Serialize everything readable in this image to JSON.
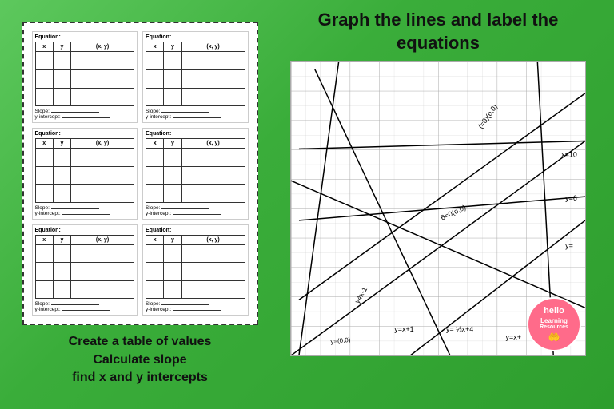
{
  "left": {
    "worksheet": {
      "blocks": [
        {
          "label": "Equation:",
          "cols": [
            "x",
            "y",
            "(x, y)"
          ]
        },
        {
          "label": "Equation:",
          "cols": [
            "x",
            "y",
            "(x, y)"
          ]
        },
        {
          "label": "Equation:",
          "cols": [
            "x",
            "y",
            "(x, y)"
          ]
        },
        {
          "label": "Equation:",
          "cols": [
            "x",
            "y",
            "(x, y)"
          ]
        },
        {
          "label": "Equation:",
          "cols": [
            "x",
            "y",
            "(x, y)"
          ]
        },
        {
          "label": "Equation:",
          "cols": [
            "x",
            "y",
            "(x, y)"
          ]
        }
      ],
      "slope_label": "Slope:",
      "intercept_label": "y-intercept:"
    },
    "caption_lines": [
      "Create a table of values",
      "Calculate slope",
      "find x and y intercepts"
    ]
  },
  "right": {
    "title": "Graph the lines and label the equations",
    "badge": {
      "hello": "hello",
      "learning": "Learning",
      "resources": "Resources"
    }
  }
}
